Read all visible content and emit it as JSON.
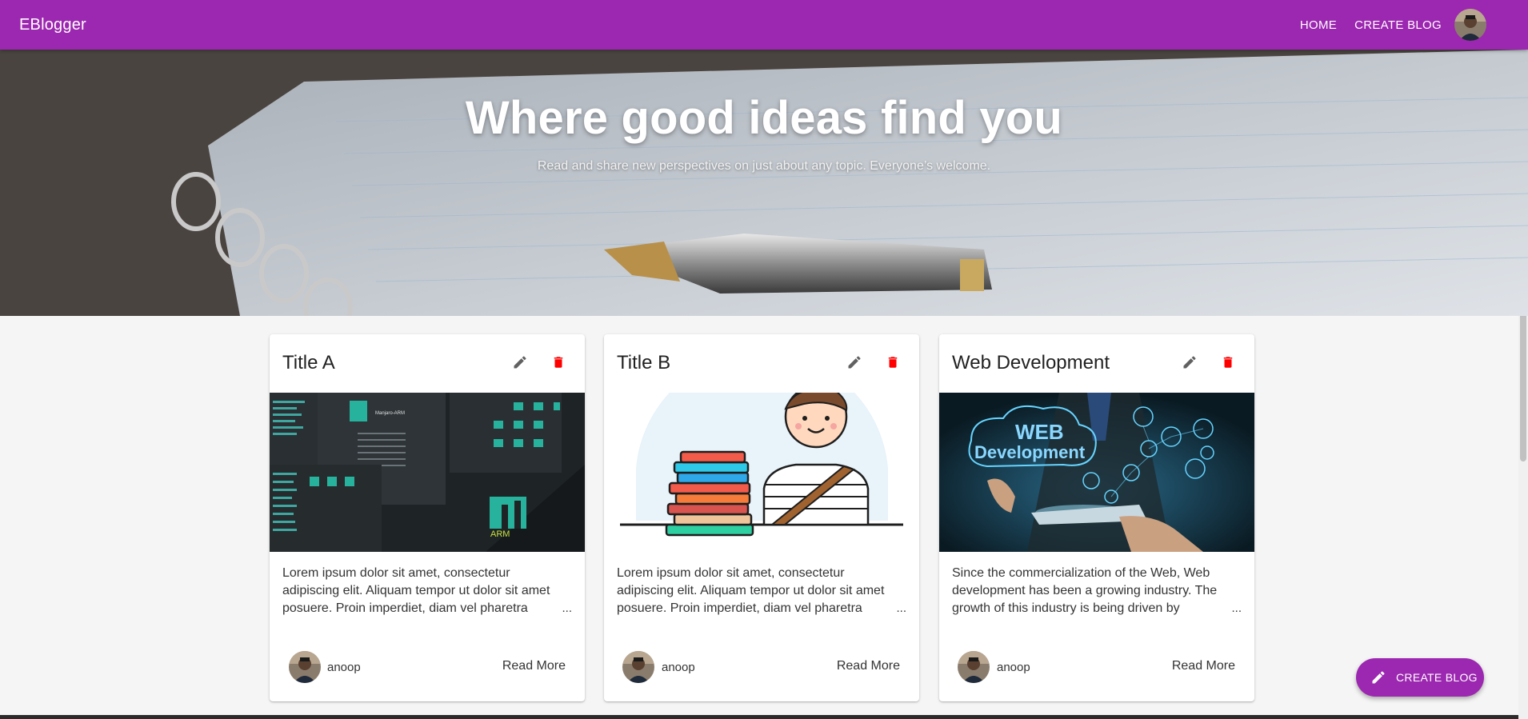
{
  "appbar": {
    "brand": "EBlogger",
    "nav": [
      "HOME",
      "CREATE BLOG"
    ],
    "color": "#9c27b0"
  },
  "hero": {
    "title": "Where good ideas find you",
    "subtitle": "Read and share new perspectives on just about any topic. Everyone’s welcome."
  },
  "cards": [
    {
      "title": "Title A",
      "image": "manjaro-desktop-screenshot",
      "excerpt": "Lorem ipsum dolor sit amet, consectetur adipiscing elit. Aliquam tempor ut dolor sit amet posuere. Proin imperdiet, diam vel pharetra",
      "ellipsis": "...",
      "author": "anoop",
      "action": "Read More"
    },
    {
      "title": "Title B",
      "image": "student-with-books-illustration",
      "excerpt": "Lorem ipsum dolor sit amet, consectetur adipiscing elit. Aliquam tempor ut dolor sit amet posuere. Proin imperdiet, diam vel pharetra",
      "ellipsis": "...",
      "author": "anoop",
      "action": "Read More"
    },
    {
      "title": "Web Development",
      "image": "web-development-tablet-photo",
      "excerpt": "Since the commercialization of the Web, Web development has been a growing industry. The growth of this industry is being driven by",
      "ellipsis": "...",
      "author": "anoop",
      "action": "Read More"
    }
  ],
  "images": {
    "manjaro_logo_text": "Manjaro-ARM",
    "arm_text": "ARM",
    "web_text_1": "WEB",
    "web_text_2": "Development"
  },
  "fab": {
    "label": "CREATE BLOG",
    "icon": "pencil-icon"
  },
  "colors": {
    "delete": "#ff0000",
    "edit": "#616161",
    "accent": "#9c27b0"
  }
}
